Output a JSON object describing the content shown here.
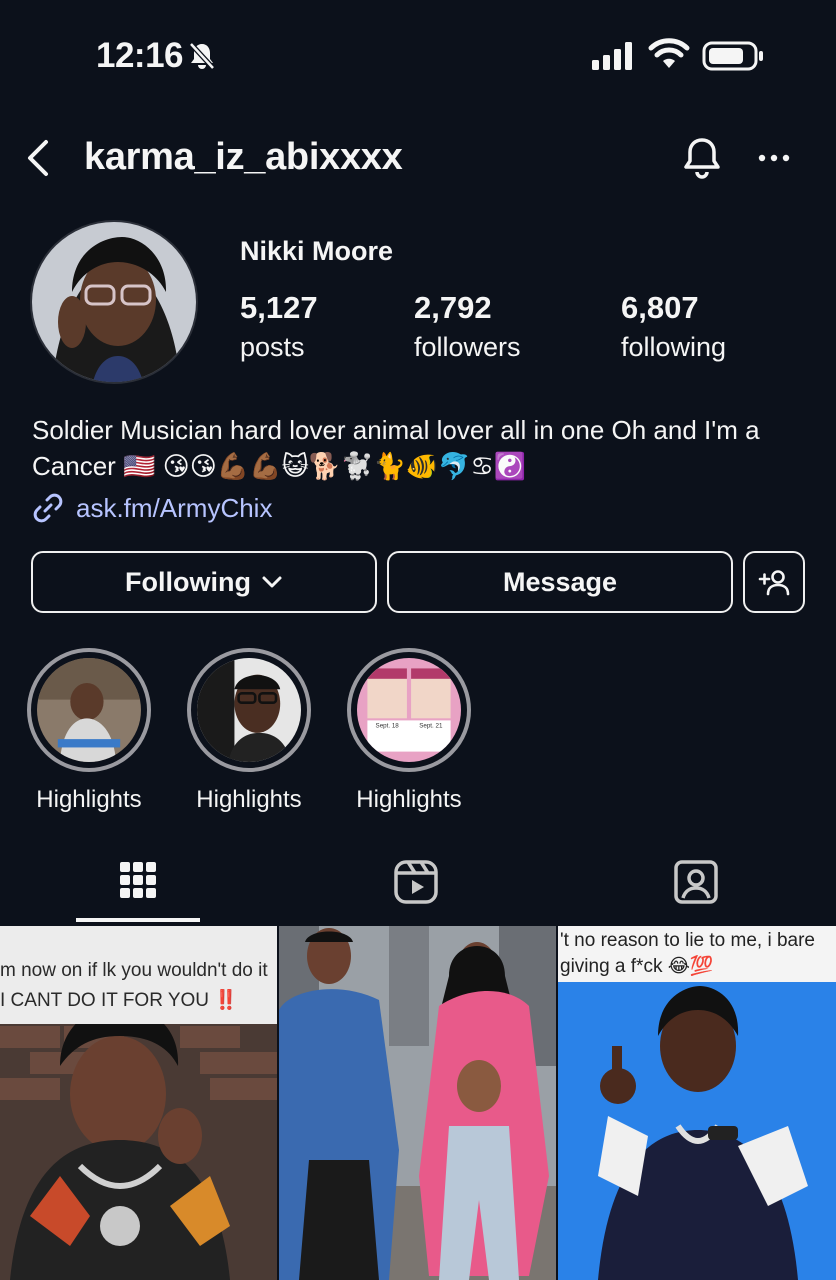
{
  "status_bar": {
    "time": "12:16"
  },
  "header": {
    "username": "karma_iz_abixxxx"
  },
  "profile": {
    "display_name": "Nikki Moore",
    "stats": [
      {
        "value": "5,127",
        "label": "posts"
      },
      {
        "value": "2,792",
        "label": "followers"
      },
      {
        "value": "6,807",
        "label": "following"
      }
    ],
    "bio": "Soldier Musician hard lover animal lover all in one Oh and I'm a Cancer 🇺🇸 😘😘💪🏾💪🏾😺🐕🐩🐈🐠🐬♋☯️",
    "link": "ask.fm/ArmyChix"
  },
  "actions": {
    "following_label": "Following",
    "message_label": "Message"
  },
  "highlights": [
    {
      "label": "Highlights"
    },
    {
      "label": "Highlights"
    },
    {
      "label": "Highlights"
    }
  ],
  "highlight3_text": {
    "left": "Sept. 18",
    "right": "Sept. 21"
  },
  "posts": [
    {
      "caption_line1": "m now on if lk you wouldn't do it",
      "caption_line2": "I CANT DO IT FOR YOU ‼️"
    },
    {},
    {
      "caption_line1": "'t no reason to lie to me, i bare",
      "caption_line2": "giving a f*ck 😂💯"
    }
  ],
  "colors": {
    "background": "#0c111b",
    "link": "#b7c4ff",
    "text": "#f5f5f5"
  }
}
